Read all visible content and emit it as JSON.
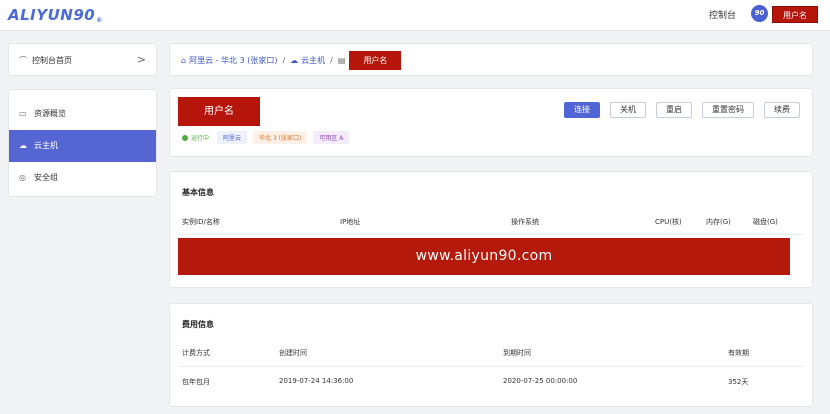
{
  "topbar": {
    "logo": "ALIYUN90",
    "logo_sub": "®",
    "console_link": "控制台",
    "avatar_text": "90",
    "user_label": "用户名"
  },
  "sidebar": {
    "home": {
      "label": "控制台首页",
      "chevron": ">"
    },
    "items": [
      {
        "label": "资源概览",
        "icon": "monitor-icon",
        "active": false
      },
      {
        "label": "云主机",
        "icon": "cloud-icon",
        "active": true
      },
      {
        "label": "安全组",
        "icon": "shield-icon",
        "active": false
      }
    ]
  },
  "breadcrumb": {
    "region": "阿里云 - 华北 3 (张家口)",
    "section": "云主机",
    "current": "用户名",
    "separator": "/"
  },
  "instance": {
    "name": "用户名",
    "status": "运行中",
    "tags": [
      "阿里云",
      "华北 3 (张家口)",
      "可用区 A"
    ],
    "actions": {
      "connect": "连接",
      "shutdown": "关机",
      "restart": "重启",
      "reset_password": "重置密码",
      "renew": "续费"
    }
  },
  "basic_info": {
    "title": "基本信息",
    "headers": [
      "实例ID/名称",
      "IP地址",
      "操作系统",
      "CPU(核)",
      "内存(G)",
      "磁盘(G)"
    ],
    "watermark": "www.aliyun90.com"
  },
  "fee_info": {
    "title": "费用信息",
    "headers": [
      "计费方式",
      "创建时间",
      "到期时间",
      "有效期"
    ],
    "row": [
      "包年包月",
      "2019-07-24 14:36:00",
      "2020-07-25 00:00:00",
      "352天"
    ]
  },
  "colors": {
    "accent": "#5166d6",
    "brand_red": "#b5150b",
    "status_green": "#52a940"
  }
}
